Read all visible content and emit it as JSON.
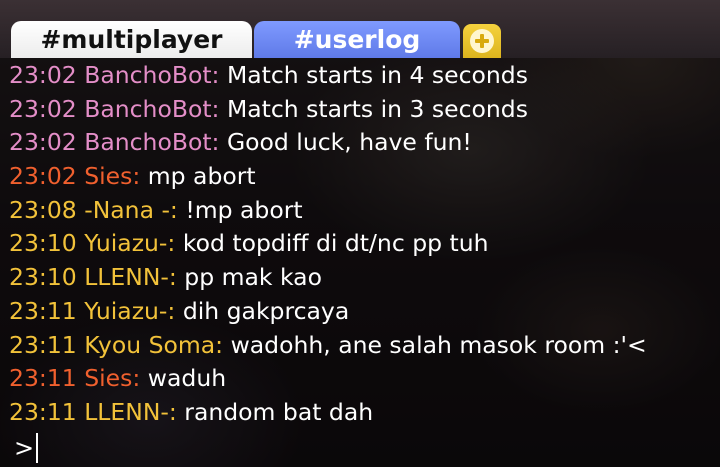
{
  "tabs": [
    {
      "label": "#multiplayer",
      "active": true
    },
    {
      "label": "#userlog",
      "active": false
    }
  ],
  "add_tab_icon": "plus-circle-icon",
  "messages": [
    {
      "time": "23:02",
      "user": "BanchoBot:",
      "text": "Match starts in 4 seconds",
      "color": "#e48ec8"
    },
    {
      "time": "23:02",
      "user": "BanchoBot:",
      "text": "Match starts in 3 seconds",
      "color": "#e48ec8"
    },
    {
      "time": "23:02",
      "user": "BanchoBot:",
      "text": "Good luck, have fun!",
      "color": "#e48ec8"
    },
    {
      "time": "23:02",
      "user": "Sies:",
      "text": "mp abort",
      "color": "#f0602e"
    },
    {
      "time": "23:08",
      "user": "-Nana -:",
      "text": "!mp abort",
      "color": "#f2c23a"
    },
    {
      "time": "23:10",
      "user": "Yuiazu-:",
      "text": "kod topdiff di dt/nc pp tuh",
      "color": "#f2c23a"
    },
    {
      "time": "23:10",
      "user": "LLENN-:",
      "text": "pp mak kao",
      "color": "#f2c23a"
    },
    {
      "time": "23:11",
      "user": "Yuiazu-:",
      "text": "dih gakprcaya",
      "color": "#f2c23a"
    },
    {
      "time": "23:11",
      "user": "Kyou Soma:",
      "text": "wadohh, ane salah masok room :'<",
      "color": "#f2c23a"
    },
    {
      "time": "23:11",
      "user": "Sies:",
      "text": "waduh",
      "color": "#f0602e"
    },
    {
      "time": "23:11",
      "user": "LLENN-:",
      "text": "random bat dah",
      "color": "#f2c23a"
    }
  ],
  "input": {
    "prompt": ">",
    "value": ""
  }
}
